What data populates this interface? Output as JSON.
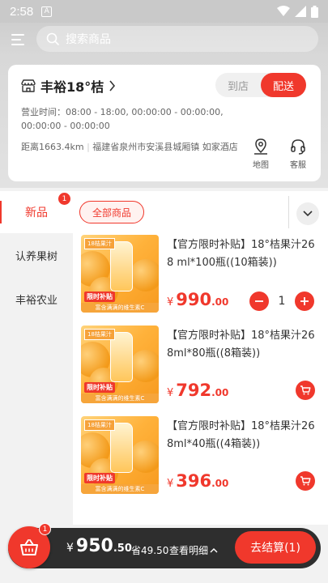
{
  "status_bar": {
    "time": "2:58",
    "notification_badge": "A"
  },
  "search": {
    "placeholder": "搜索商品"
  },
  "store": {
    "name": "丰裕18°桔",
    "modes": [
      {
        "label": "到店",
        "active": false
      },
      {
        "label": "配送",
        "active": true
      }
    ],
    "hours": "营业时间：08:00 - 18:00, 00:00:00 - 00:00:00, 00:00:00 - 00:00:00",
    "distance": "距离1663.4km",
    "address": "福建省泉州市安溪县城厢镇 如家酒店",
    "actions": {
      "map": "地图",
      "service": "客服"
    }
  },
  "tabs": {
    "new_label": "新品",
    "new_badge": "1",
    "all_label": "全部商品"
  },
  "sidebar": {
    "items": [
      {
        "label": "认养果树"
      },
      {
        "label": "丰裕农业"
      }
    ]
  },
  "products": [
    {
      "title": "【官方限时补贴】18°桔果汁268 ml*100瓶((10箱装))",
      "currency": "¥",
      "price_int": "990",
      "price_dec": ".00",
      "quantity": "1"
    },
    {
      "title": "【官方限时补贴】18°桔果汁268ml*80瓶((8箱装))",
      "currency": "¥",
      "price_int": "792",
      "price_dec": ".00"
    },
    {
      "title": "【官方限时补贴】18°桔果汁268ml*40瓶((4箱装))",
      "currency": "¥",
      "price_int": "396",
      "price_dec": ".00"
    }
  ],
  "product_image": {
    "top_tag": "18桔果汁",
    "promo": "限时补贴",
    "strip": "富含满满的维生素C"
  },
  "cart": {
    "badge": "1",
    "currency": "¥",
    "total_int": "950",
    "total_dec": ".50",
    "saved": "省49.50",
    "details": "查看明细",
    "checkout": "去结算(1)"
  },
  "colors": {
    "accent": "#f0382c",
    "bar": "#2e2e2e"
  }
}
